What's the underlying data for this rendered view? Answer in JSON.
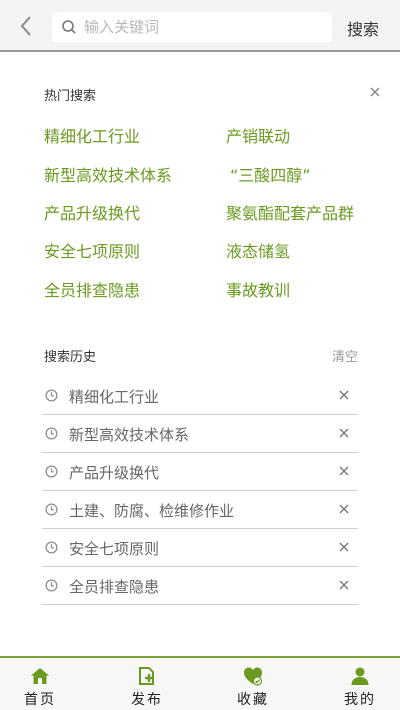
{
  "header": {
    "search_placeholder": "输入关键词",
    "search_button": "搜索"
  },
  "hot_search": {
    "title": "热门搜索",
    "items": [
      "精细化工行业",
      "产销联动",
      "新型高效技术体系",
      "“三酸四醇”",
      "产品升级换代",
      "聚氨酯配套产品群",
      "安全七项原则",
      "液态储氢",
      "全员排查隐患",
      "事故教训"
    ]
  },
  "history": {
    "title": "搜索历史",
    "clear_label": "清空",
    "items": [
      "精细化工行业",
      "新型高效技术体系",
      "产品升级换代",
      "土建、防腐、检维修作业",
      "安全七项原则",
      "全员排查隐患"
    ]
  },
  "tabbar": {
    "tabs": [
      "首页",
      "发布",
      "收藏",
      "我的"
    ]
  },
  "colors": {
    "accent_green": "#6a9a1f",
    "icon_green": "#7aa13a"
  }
}
